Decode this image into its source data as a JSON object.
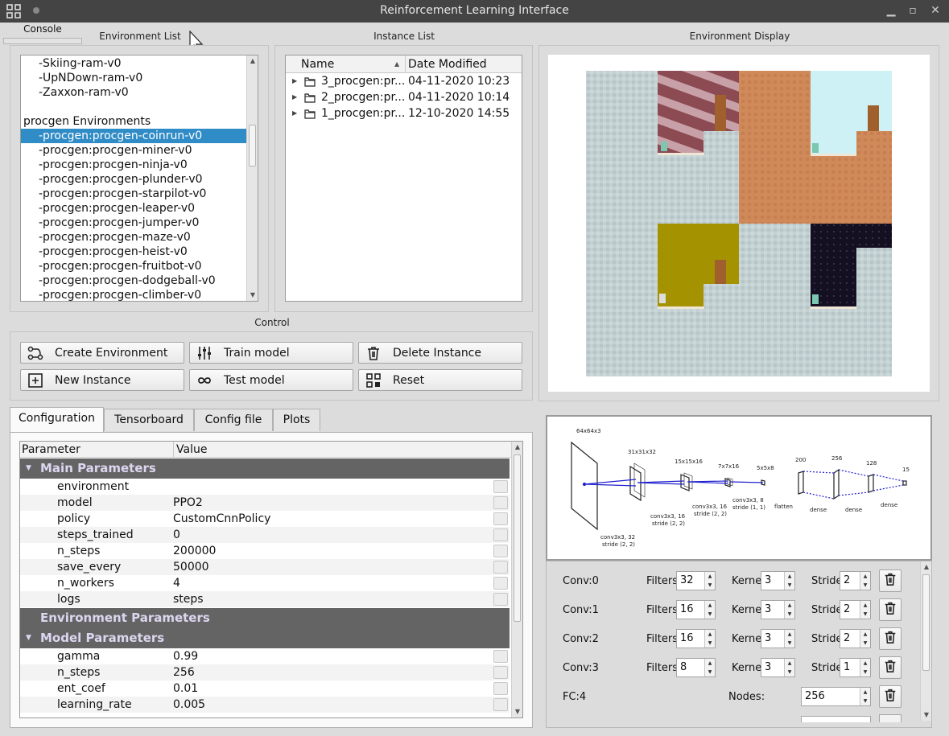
{
  "window": {
    "title": "Reinforcement Learning Interface"
  },
  "console_tab": "Console",
  "env_list": {
    "label": "Environment List",
    "items": [
      {
        "text": "-Skiing-ram-v0",
        "type": "item"
      },
      {
        "text": "-UpNDown-ram-v0",
        "type": "item"
      },
      {
        "text": "-Zaxxon-ram-v0",
        "type": "item"
      },
      {
        "text": "",
        "type": "blank"
      },
      {
        "text": "procgen Environments",
        "type": "category"
      },
      {
        "text": "-procgen:procgen-coinrun-v0",
        "type": "item",
        "selected": true
      },
      {
        "text": "-procgen:procgen-miner-v0",
        "type": "item"
      },
      {
        "text": "-procgen:procgen-ninja-v0",
        "type": "item"
      },
      {
        "text": "-procgen:procgen-plunder-v0",
        "type": "item"
      },
      {
        "text": "-procgen:procgen-starpilot-v0",
        "type": "item"
      },
      {
        "text": "-procgen:procgen-leaper-v0",
        "type": "item"
      },
      {
        "text": "-procgen:procgen-jumper-v0",
        "type": "item"
      },
      {
        "text": "-procgen:procgen-maze-v0",
        "type": "item"
      },
      {
        "text": "-procgen:procgen-heist-v0",
        "type": "item"
      },
      {
        "text": "-procgen:procgen-fruitbot-v0",
        "type": "item"
      },
      {
        "text": "-procgen:procgen-dodgeball-v0",
        "type": "item"
      },
      {
        "text": "-procgen:procgen-climber-v0",
        "type": "item"
      }
    ]
  },
  "instance_list": {
    "label": "Instance List",
    "col_name": "Name",
    "col_date": "Date Modified",
    "rows": [
      {
        "name": "3_procgen:pr...",
        "date": "04-11-2020 10:23"
      },
      {
        "name": "2_procgen:pr...",
        "date": "04-11-2020 10:14"
      },
      {
        "name": "1_procgen:pr...",
        "date": "12-10-2020 14:55"
      }
    ]
  },
  "env_display": {
    "label": "Environment Display"
  },
  "control": {
    "label": "Control",
    "buttons": {
      "create": "Create Environment",
      "train": "Train model",
      "delete": "Delete Instance",
      "new": "New Instance",
      "test": "Test model",
      "reset": "Reset"
    }
  },
  "tabs": [
    "Configuration",
    "Tensorboard",
    "Config file",
    "Plots"
  ],
  "config": {
    "col_param": "Parameter",
    "col_value": "Value",
    "sections": {
      "main": "Main Parameters",
      "env": "Environment Parameters",
      "model": "Model Parameters"
    },
    "main_params": [
      {
        "k": "environment",
        "v": ""
      },
      {
        "k": "model",
        "v": "PPO2"
      },
      {
        "k": "policy",
        "v": "CustomCnnPolicy"
      },
      {
        "k": "steps_trained",
        "v": "0"
      },
      {
        "k": "n_steps",
        "v": "200000"
      },
      {
        "k": "save_every",
        "v": "50000"
      },
      {
        "k": "n_workers",
        "v": "4"
      },
      {
        "k": "logs",
        "v": "steps"
      }
    ],
    "model_params": [
      {
        "k": "gamma",
        "v": "0.99"
      },
      {
        "k": "n_steps",
        "v": "256"
      },
      {
        "k": "ent_coef",
        "v": "0.01"
      },
      {
        "k": "learning_rate",
        "v": "0.005"
      }
    ]
  },
  "network": {
    "diagram": {
      "input": "64x64x3",
      "c1": "31x31x32",
      "c2": "15x15x16",
      "c3": "7x7x16",
      "c4": "5x5x8",
      "d1": "200",
      "d2": "256",
      "d3": "128",
      "d4": "15",
      "op1": [
        "conv3x3, 32",
        "stride (2, 2)"
      ],
      "op2": [
        "conv3x3, 16",
        "stride (2, 2)"
      ],
      "op3": [
        "conv3x3, 16",
        "stride (2, 2)"
      ],
      "op4": [
        "conv3x3, 8",
        "stride (1, 1)"
      ],
      "op5": "flatten",
      "op6": "dense",
      "op7": "dense",
      "op8": "dense"
    },
    "labels": {
      "filters": "Filters:",
      "kernel": "Kernel:",
      "stride": "Stride:",
      "nodes": "Nodes:"
    },
    "layers": [
      {
        "name": "Conv:0",
        "filters": "32",
        "kernel": "3",
        "stride": "2"
      },
      {
        "name": "Conv:1",
        "filters": "16",
        "kernel": "3",
        "stride": "2"
      },
      {
        "name": "Conv:2",
        "filters": "16",
        "kernel": "3",
        "stride": "2"
      },
      {
        "name": "Conv:3",
        "filters": "8",
        "kernel": "3",
        "stride": "1"
      }
    ],
    "fc": {
      "name": "FC:4",
      "nodes": "256"
    }
  }
}
